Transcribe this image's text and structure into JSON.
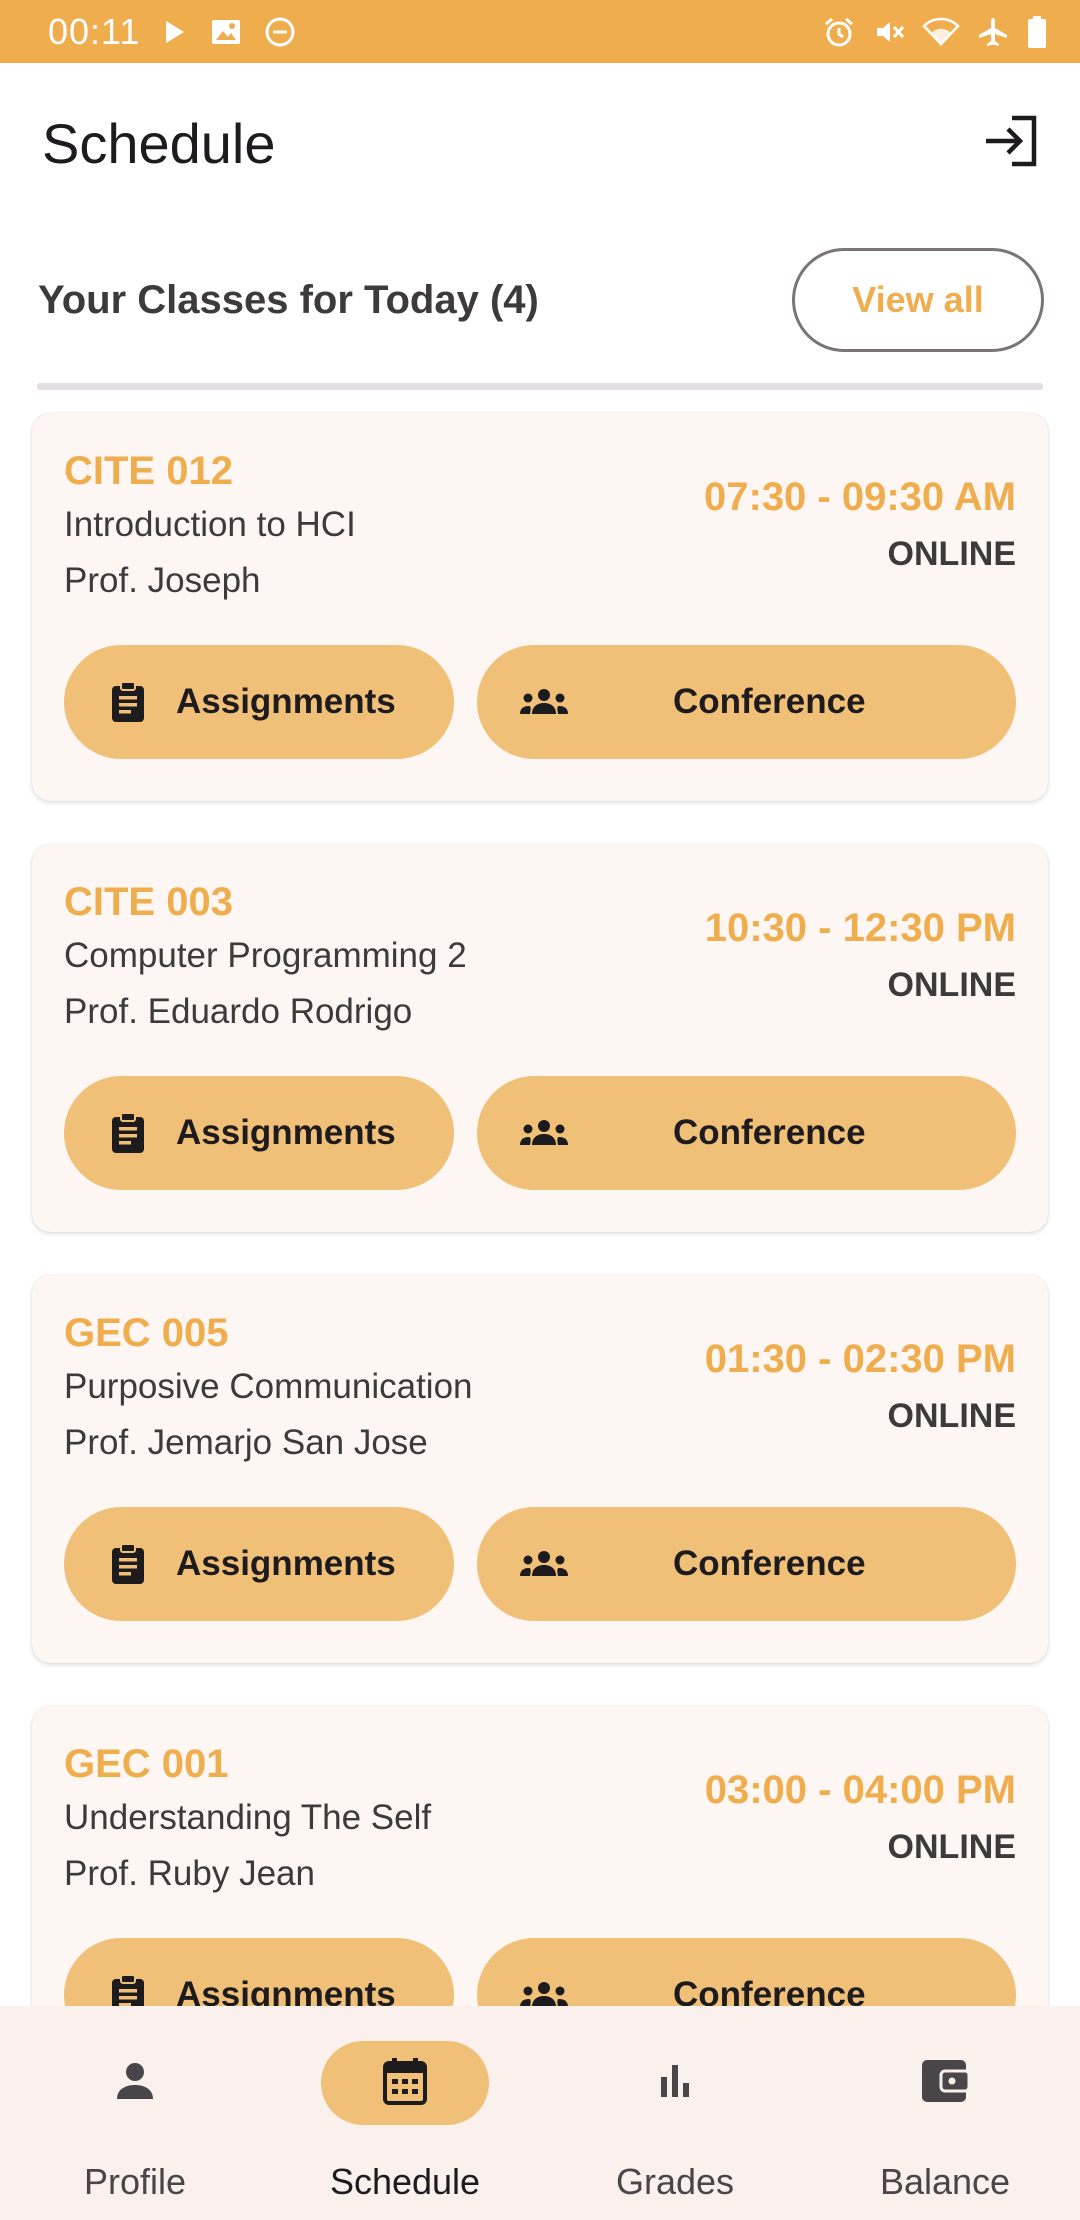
{
  "status_bar": {
    "time": "00:11",
    "left_icons": [
      "play-icon",
      "image-icon",
      "do-not-disturb-icon"
    ],
    "right_icons": [
      "alarm-icon",
      "mute-icon",
      "wifi-icon",
      "airplane-icon",
      "battery-icon"
    ]
  },
  "app_bar": {
    "title": "Schedule",
    "logout_icon": "logout-icon"
  },
  "section": {
    "title": "Your Classes for Today (4)",
    "view_all": "View all"
  },
  "classes": [
    {
      "code": "CITE 012",
      "name": "Introduction to HCI",
      "professor": "Prof. Joseph",
      "time": "07:30 - 09:30 AM",
      "mode": "ONLINE",
      "assignments_label": "Assignments",
      "conference_label": "Conference"
    },
    {
      "code": "CITE 003",
      "name": "Computer Programming 2",
      "professor": "Prof. Eduardo Rodrigo",
      "time": "10:30 - 12:30 PM",
      "mode": "ONLINE",
      "assignments_label": "Assignments",
      "conference_label": "Conference"
    },
    {
      "code": "GEC 005",
      "name": "Purposive Communication",
      "professor": "Prof. Jemarjo San Jose",
      "time": "01:30 - 02:30 PM",
      "mode": "ONLINE",
      "assignments_label": "Assignments",
      "conference_label": "Conference"
    },
    {
      "code": "GEC 001",
      "name": "Understanding The Self",
      "professor": "Prof. Ruby Jean",
      "time": "03:00 - 04:00 PM",
      "mode": "ONLINE",
      "assignments_label": "Assignments",
      "conference_label": "Conference"
    }
  ],
  "bottom_nav": {
    "items": [
      {
        "label": "Profile",
        "icon": "person-icon",
        "active": false
      },
      {
        "label": "Schedule",
        "icon": "calendar-icon",
        "active": true
      },
      {
        "label": "Grades",
        "icon": "bar-chart-icon",
        "active": false
      },
      {
        "label": "Balance",
        "icon": "wallet-icon",
        "active": false
      }
    ]
  },
  "colors": {
    "accent": "#F0AD4E",
    "button_fill": "#F0C078",
    "card_bg": "#FDF6F2",
    "nav_bg": "#FBF1EC",
    "text_dark": "#3D3A3C"
  }
}
